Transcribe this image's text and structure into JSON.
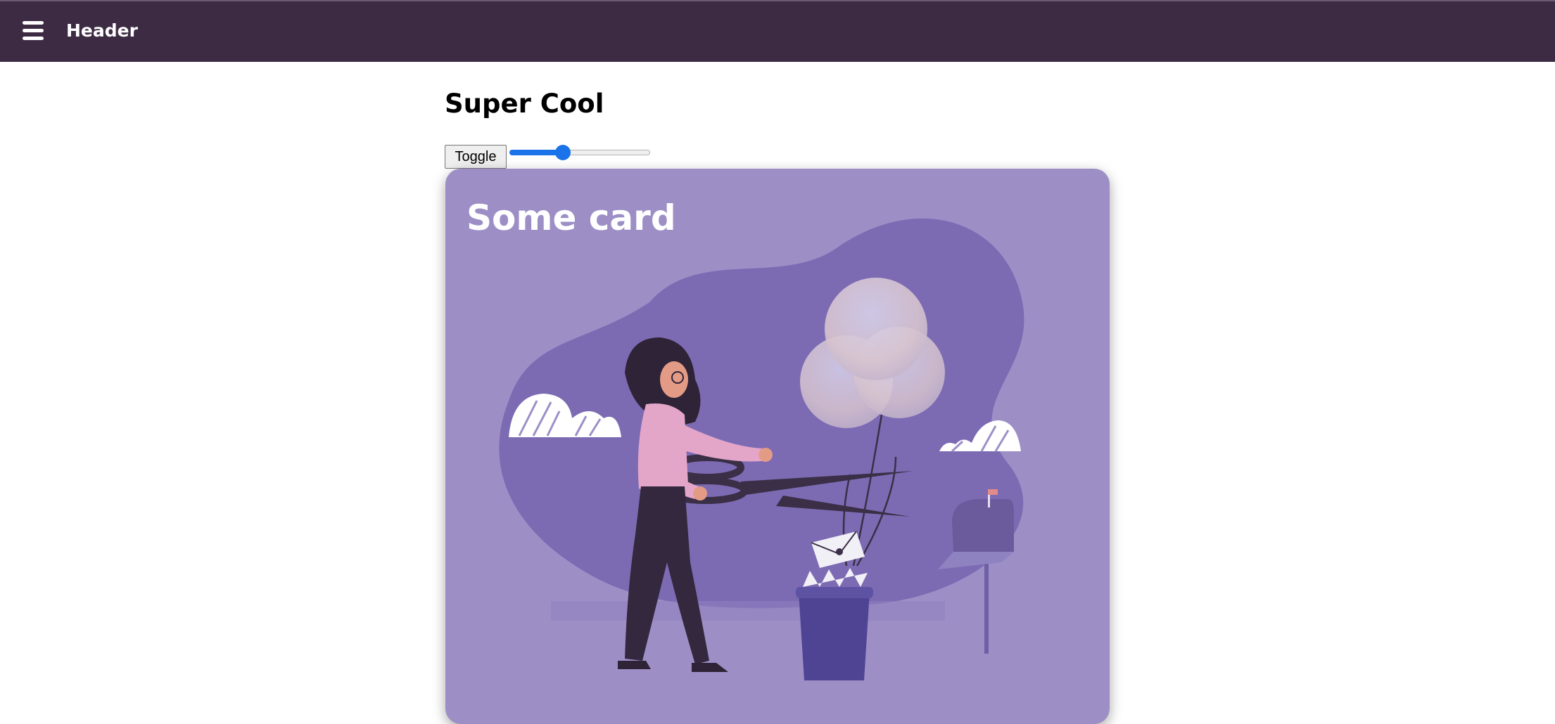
{
  "header": {
    "title": "Header",
    "menu_icon": "hamburger-menu-icon"
  },
  "page": {
    "title": "Super Cool"
  },
  "controls": {
    "toggle_label": "Toggle",
    "slider_value_fraction": 0.38
  },
  "card": {
    "title": "Some card",
    "background": "#9d8fc6",
    "illustration": "woman-cutting-balloons-illustration"
  },
  "colors": {
    "header_bg": "#3c2b43",
    "accent": "#1a73e8",
    "blob": "#7c6bb3"
  }
}
